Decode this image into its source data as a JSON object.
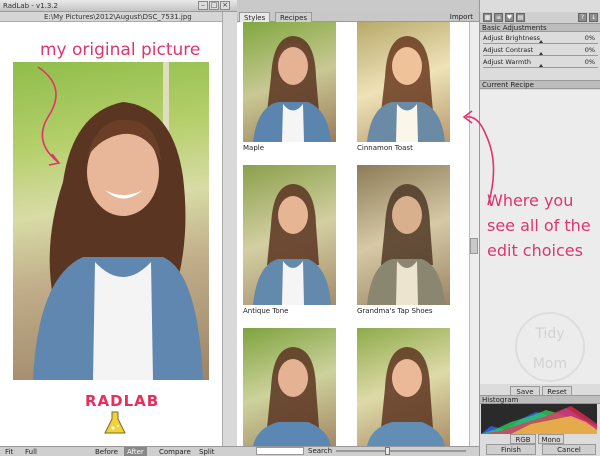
{
  "window": {
    "title": "RadLab - v1.3.2",
    "path": "E:\\My Pictures\\2012\\August\\DSC_7531.jpg"
  },
  "annotations": {
    "original": "my original picture",
    "edit_line1": "Where you",
    "edit_line2": "see all of the",
    "edit_line3": "edit choices"
  },
  "brand": {
    "logo_text": "RADLAB"
  },
  "tabs": [
    {
      "label": "Styles"
    },
    {
      "label": "Recipes"
    }
  ],
  "import_label": "Import",
  "thumbnails": [
    {
      "label": "Maple"
    },
    {
      "label": "Cinnamon Toast"
    },
    {
      "label": "Antique Tone"
    },
    {
      "label": "Grandma's Tap Shoes"
    },
    {
      "label": ""
    },
    {
      "label": ""
    }
  ],
  "basic_adjustments": {
    "header": "Basic Adjustments",
    "rows": [
      {
        "label": "Adjust Brightness",
        "value": "0%"
      },
      {
        "label": "Adjust Contrast",
        "value": "0%"
      },
      {
        "label": "Adjust Warmth",
        "value": "0%"
      }
    ]
  },
  "current_recipe": {
    "header": "Current Recipe",
    "save": "Save",
    "reset": "Reset"
  },
  "watermark": {
    "text": "Tidy Mom"
  },
  "histogram": {
    "header": "Histogram",
    "rgb": "RGB",
    "mono": "Mono"
  },
  "actions": {
    "finish": "Finish",
    "cancel": "Cancel"
  },
  "bottom_bar": {
    "left_buttons": [
      "Fit",
      "Full"
    ],
    "view_buttons": [
      "Before",
      "After",
      "Compare",
      "Split"
    ],
    "active_view": "After",
    "search_label": "Search"
  },
  "colors": {
    "accent_pink": "#e0346d",
    "panel_grey": "#dcdcdc",
    "gallery_bg": "#ffffff"
  }
}
